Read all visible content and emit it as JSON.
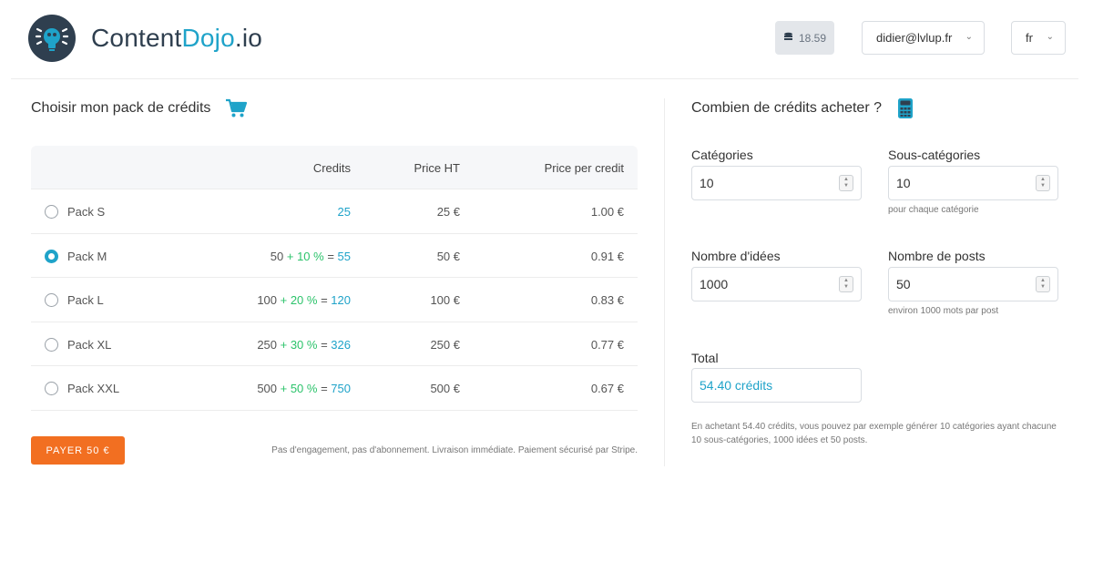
{
  "brand": {
    "name_prefix": "Content",
    "name_accent": "Dojo",
    "name_suffix": ".io",
    "accent_color": "#1fa3c9"
  },
  "header": {
    "credits_balance": "18.59",
    "user_email": "didier@lvlup.fr",
    "language": "fr"
  },
  "left": {
    "title": "Choisir mon pack de crédits",
    "columns": {
      "credits": "Credits",
      "price_ht": "Price HT",
      "price_per_credit": "Price per credit"
    },
    "packs": [
      {
        "name": "Pack S",
        "base": "",
        "bonus": "",
        "eq": "",
        "total": "25",
        "price": "25 €",
        "ppc": "1.00 €",
        "selected": false
      },
      {
        "name": "Pack M",
        "base": "50 ",
        "bonus": "+ 10 %",
        "eq": " = ",
        "total": "55",
        "price": "50 €",
        "ppc": "0.91 €",
        "selected": true
      },
      {
        "name": "Pack L",
        "base": "100 ",
        "bonus": "+ 20 %",
        "eq": " = ",
        "total": "120",
        "price": "100 €",
        "ppc": "0.83 €",
        "selected": false
      },
      {
        "name": "Pack XL",
        "base": "250 ",
        "bonus": "+ 30 %",
        "eq": " = ",
        "total": "326",
        "price": "250 €",
        "ppc": "0.77 €",
        "selected": false
      },
      {
        "name": "Pack XXL",
        "base": "500 ",
        "bonus": "+ 50 %",
        "eq": " = ",
        "total": "750",
        "price": "500 €",
        "ppc": "0.67 €",
        "selected": false
      }
    ],
    "pay_button": "PAYER 50 €",
    "note": "Pas d'engagement, pas d'abonnement. Livraison immédiate. Paiement sécurisé par Stripe."
  },
  "right": {
    "title": "Combien de crédits acheter ?",
    "categories_label": "Catégories",
    "categories_value": "10",
    "subcategories_label": "Sous-catégories",
    "subcategories_value": "10",
    "subcategories_hint": "pour chaque catégorie",
    "ideas_label": "Nombre d'idées",
    "ideas_value": "1000",
    "posts_label": "Nombre de posts",
    "posts_value": "50",
    "posts_hint": "environ 1000 mots par post",
    "total_label": "Total",
    "total_value": "54.40 crédits",
    "summary": "En achetant 54.40 crédits, vous pouvez par exemple générer 10 catégories ayant chacune 10 sous-catégories, 1000 idées et 50 posts."
  },
  "icons": {
    "logo": "lightbulb-icon",
    "coins": "coins-icon",
    "cart": "cart-icon",
    "calculator": "calculator-icon",
    "chevron": "chevron-down-icon"
  }
}
